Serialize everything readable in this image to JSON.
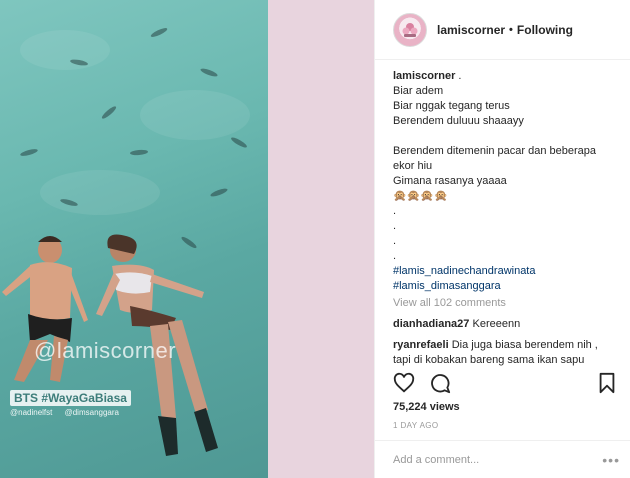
{
  "post": {
    "username": "lamiscorner",
    "follow_label": "Following",
    "separator": "•"
  },
  "media": {
    "watermark": "@lamiscorner",
    "badge": "BTS #WayaGaBiasa",
    "tag_1": "@nadinelfst",
    "tag_2": "@dimsanggara"
  },
  "caption": {
    "user": "lamiscorner",
    "user_suffix": " .",
    "lines": [
      "Biar adem",
      "Biar nggak tegang terus",
      "Berendem duluuu shaaayy",
      "Berendem ditemenin pacar dan beberapa",
      "ekor hiu",
      "Gimana rasanya yaaaa",
      "🙊🙊🙊🙊",
      ".",
      ".",
      ".",
      "."
    ],
    "hashtags": [
      "#lamis_nadinechandrawinata",
      "#lamis_dimasanggara"
    ]
  },
  "view_all_comments": "View all 102 comments",
  "comments": [
    {
      "user": "dianhadiana27",
      "text": "Kereeenn"
    },
    {
      "user": "ryanrefaeli",
      "text": "Dia juga biasa berendem nih ,",
      "text_2": "tapi di kobakan bareng sama ikan sapu"
    }
  ],
  "stats": {
    "views": "75,224 views",
    "date": "1 DAY AGO"
  },
  "add_comment": {
    "placeholder": "Add a comment...",
    "more": "•••"
  },
  "icons": {
    "like": "heart-icon",
    "comment": "comment-icon",
    "save": "bookmark-icon",
    "more": "more-options-icon"
  },
  "colors": {
    "hashtag": "#003569",
    "muted": "#999999",
    "gap": "#e8d4de"
  }
}
